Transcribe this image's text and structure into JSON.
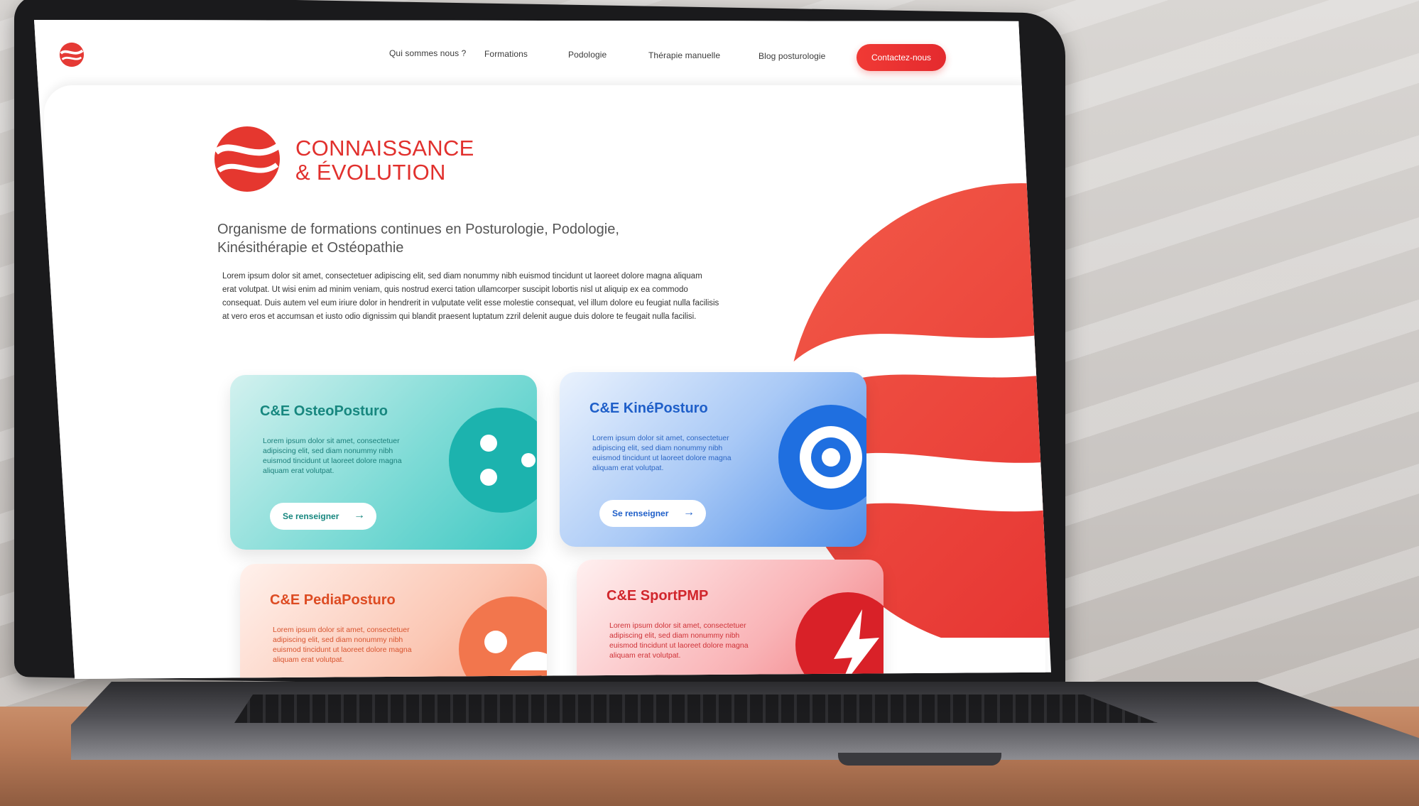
{
  "nav": {
    "items": [
      "Qui sommes nous ?",
      "Formations",
      "Podologie",
      "Thérapie manuelle",
      "Blog posturologie"
    ],
    "cta": "Contactez-nous"
  },
  "hero": {
    "brand_line1": "CONNAISSANCE",
    "brand_line2": "& ÉVOLUTION",
    "tagline_line1": "Organisme de formations continues en Posturologie, Podologie,",
    "tagline_line2": "Kinésithérapie et Ostéopathie",
    "intro_lines": [
      "Lorem ipsum dolor sit amet, consectetuer adipiscing elit, sed diam nonummy nibh euismod tincidunt ut laoreet dolore magna aliquam",
      "erat volutpat. Ut wisi enim ad minim veniam, quis nostrud exerci tation ullamcorper suscipit lobortis nisl ut aliquip ex ea commodo",
      "consequat. Duis autem vel eum iriure dolor in hendrerit in vulputate velit esse molestie consequat, vel illum dolore eu feugiat nulla facilisis",
      "at vero eros et accumsan et iusto odio dignissim qui blandit praesent luptatum zzril delenit augue duis dolore te feugait nulla facilisi."
    ]
  },
  "cards": [
    {
      "title": "C&E OsteoPosturo",
      "text_lines": [
        "Lorem ipsum dolor sit amet, consectetuer",
        "adipiscing elit, sed diam nonummy nibh",
        "euismod tincidunt ut laoreet dolore magna",
        "aliquam erat volutpat."
      ],
      "button": "Se renseigner",
      "color": "#1a9b9b"
    },
    {
      "title": "C&E KinéPosturo",
      "text_lines": [
        "Lorem ipsum dolor sit amet, consectetuer",
        "adipiscing elit, sed diam nonummy nibh",
        "euismod tincidunt ut laoreet dolore magna",
        "aliquam erat volutpat."
      ],
      "button": "Se renseigner",
      "color": "#1f5fd0"
    },
    {
      "title": "C&E PediaPosturo",
      "text_lines": [
        "Lorem ipsum dolor sit amet, consectetuer",
        "adipiscing elit, sed diam nonummy nibh",
        "euismod tincidunt ut laoreet dolore magna",
        "aliquam erat volutpat."
      ],
      "button": "",
      "color": "#e2542a"
    },
    {
      "title": "C&E SportPMP",
      "text_lines": [
        "Lorem ipsum dolor sit amet, consectetuer",
        "adipiscing elit, sed diam nonummy nibh",
        "euismod tincidunt ut laoreet dolore magna",
        "aliquam erat volutpat."
      ],
      "button": "",
      "color": "#d8252b"
    }
  ],
  "colors": {
    "brand_red": "#e1302d",
    "teal": "#3ccbc8",
    "blue": "#3b86e8",
    "peach": "#f7a58c",
    "rose": "#f47a80"
  }
}
